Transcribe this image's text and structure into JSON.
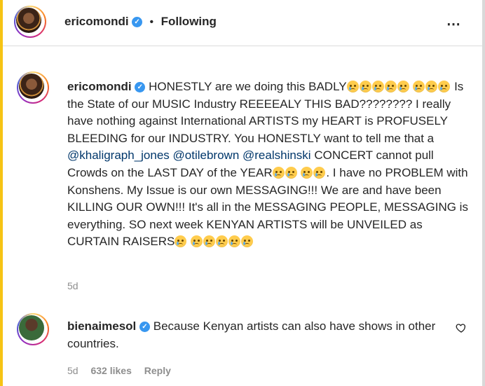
{
  "header": {
    "username": "ericomondi",
    "separator": "•",
    "follow_status": "Following",
    "more_icon": "⋯"
  },
  "caption": {
    "username": "ericomondi",
    "seg1": "HONESTLY are we doing this BADLY",
    "seg2": " Is the State of our MUSIC Industry REEEEALY THIS BAD???????? I really have nothing against International ARTISTS my HEART is PROFUSELY BLEEDING for our INDUSTRY. You HONESTLY want to tell me that a ",
    "mention1": "@khaligraph_jones",
    "mention2": "@otilebrown",
    "mention3": "@realshinski",
    "seg3": " CONCERT cannot pull Crowds on the LAST DAY of the YEAR",
    "seg4": ". I have no PROBLEM with Konshens. My Issue is our own MESSAGING!!! We are and have been KILLING OUR OWN!!! It's all in the MESSAGING PEOPLE, MESSAGING is everything. SO next week KENYAN ARTISTS will be UNVEILED as CURTAIN RAISERS",
    "time": "5d"
  },
  "comment": {
    "username": "bienaimesol",
    "text": "Because Kenyan artists can also have shows in other countries.",
    "time": "5d",
    "likes": "632 likes",
    "reply": "Reply"
  },
  "colors": {
    "verified": "#3897f0",
    "mention": "#00376b",
    "muted": "#8e8e8e"
  }
}
